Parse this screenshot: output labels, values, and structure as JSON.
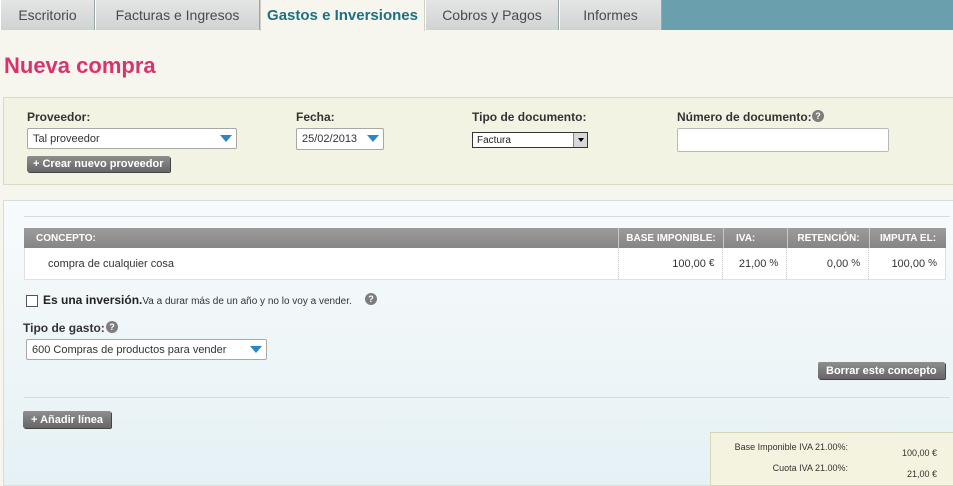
{
  "tabs": [
    {
      "label": "Escritorio"
    },
    {
      "label": "Facturas e Ingresos"
    },
    {
      "label": "Gastos e Inversiones"
    },
    {
      "label": "Cobros y Pagos"
    },
    {
      "label": "Informes"
    }
  ],
  "page_title": "Nueva compra",
  "form": {
    "proveedor_label": "Proveedor:",
    "proveedor_value": "Tal proveedor",
    "crear_proveedor": "+ Crear nuevo proveedor",
    "fecha_label": "Fecha:",
    "fecha_value": "25/02/2013",
    "tipo_doc_label": "Tipo de documento:",
    "tipo_doc_value": "Factura",
    "num_doc_label": "Número de documento:",
    "num_doc_value": ""
  },
  "table": {
    "headers": [
      "CONCEPTO:",
      "BASE IMPONIBLE:",
      "IVA:",
      "RETENCIÓN:",
      "IMPUTA EL:"
    ],
    "row": {
      "concepto": "compra de cualquier cosa",
      "base": "100,00",
      "base_unit": "€",
      "iva": "21,00",
      "iva_unit": "%",
      "retencion": "0,00",
      "retencion_unit": "%",
      "imputa": "100,00",
      "imputa_unit": "%"
    }
  },
  "inversion": {
    "label": "Es una inversión.",
    "desc": "Va a durar más de un año y no lo voy a vender."
  },
  "tipo_gasto": {
    "label": "Tipo de gasto:",
    "value": "600 Compras de productos para vender"
  },
  "buttons": {
    "borrar": "Borrar este concepto",
    "anadir": "+ Añadir línea"
  },
  "totals": [
    {
      "label": "Base Imponible IVA 21.00%:",
      "value": "100,00 €"
    },
    {
      "label": "Cuota IVA 21.00%:",
      "value": "21,00 €"
    }
  ],
  "colors": {
    "title": "#d8336e",
    "active_tab": "#1f6f82",
    "tabbar": "#6aa0ae",
    "dropdown_arrow": "#2a86c8"
  }
}
